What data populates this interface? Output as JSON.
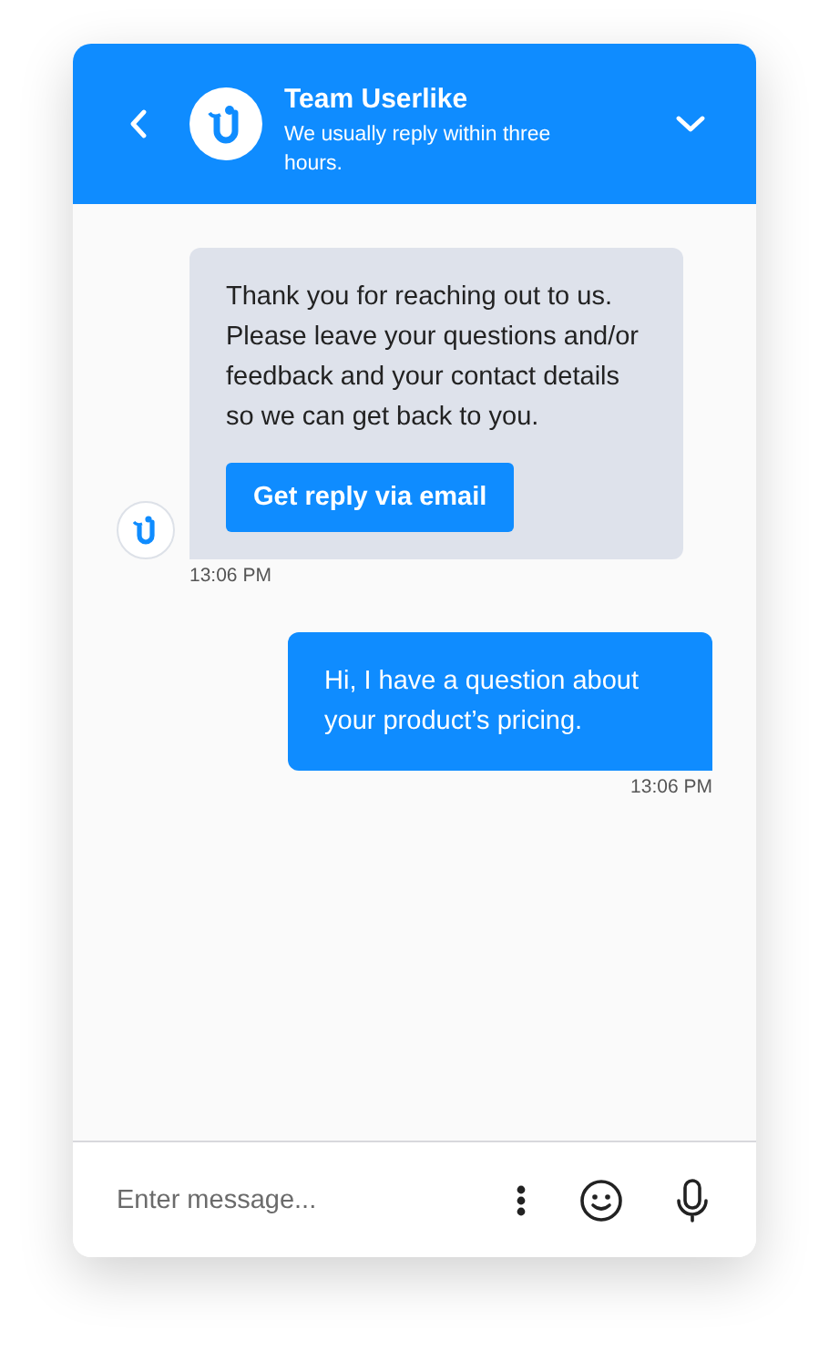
{
  "header": {
    "title": "Team Userlike",
    "subtitle": "We usually reply within three hours."
  },
  "messages": [
    {
      "kind": "agent",
      "text": "Thank you for reaching out to us. Please leave your questions and/or feedback and your contact details so we can get back to you.",
      "button": "Get reply via email",
      "time": "13:06 PM"
    },
    {
      "kind": "user",
      "text": "Hi, I have a question about your product’s pricing.",
      "time": "13:06 PM"
    }
  ],
  "composer": {
    "placeholder": "Enter message..."
  }
}
